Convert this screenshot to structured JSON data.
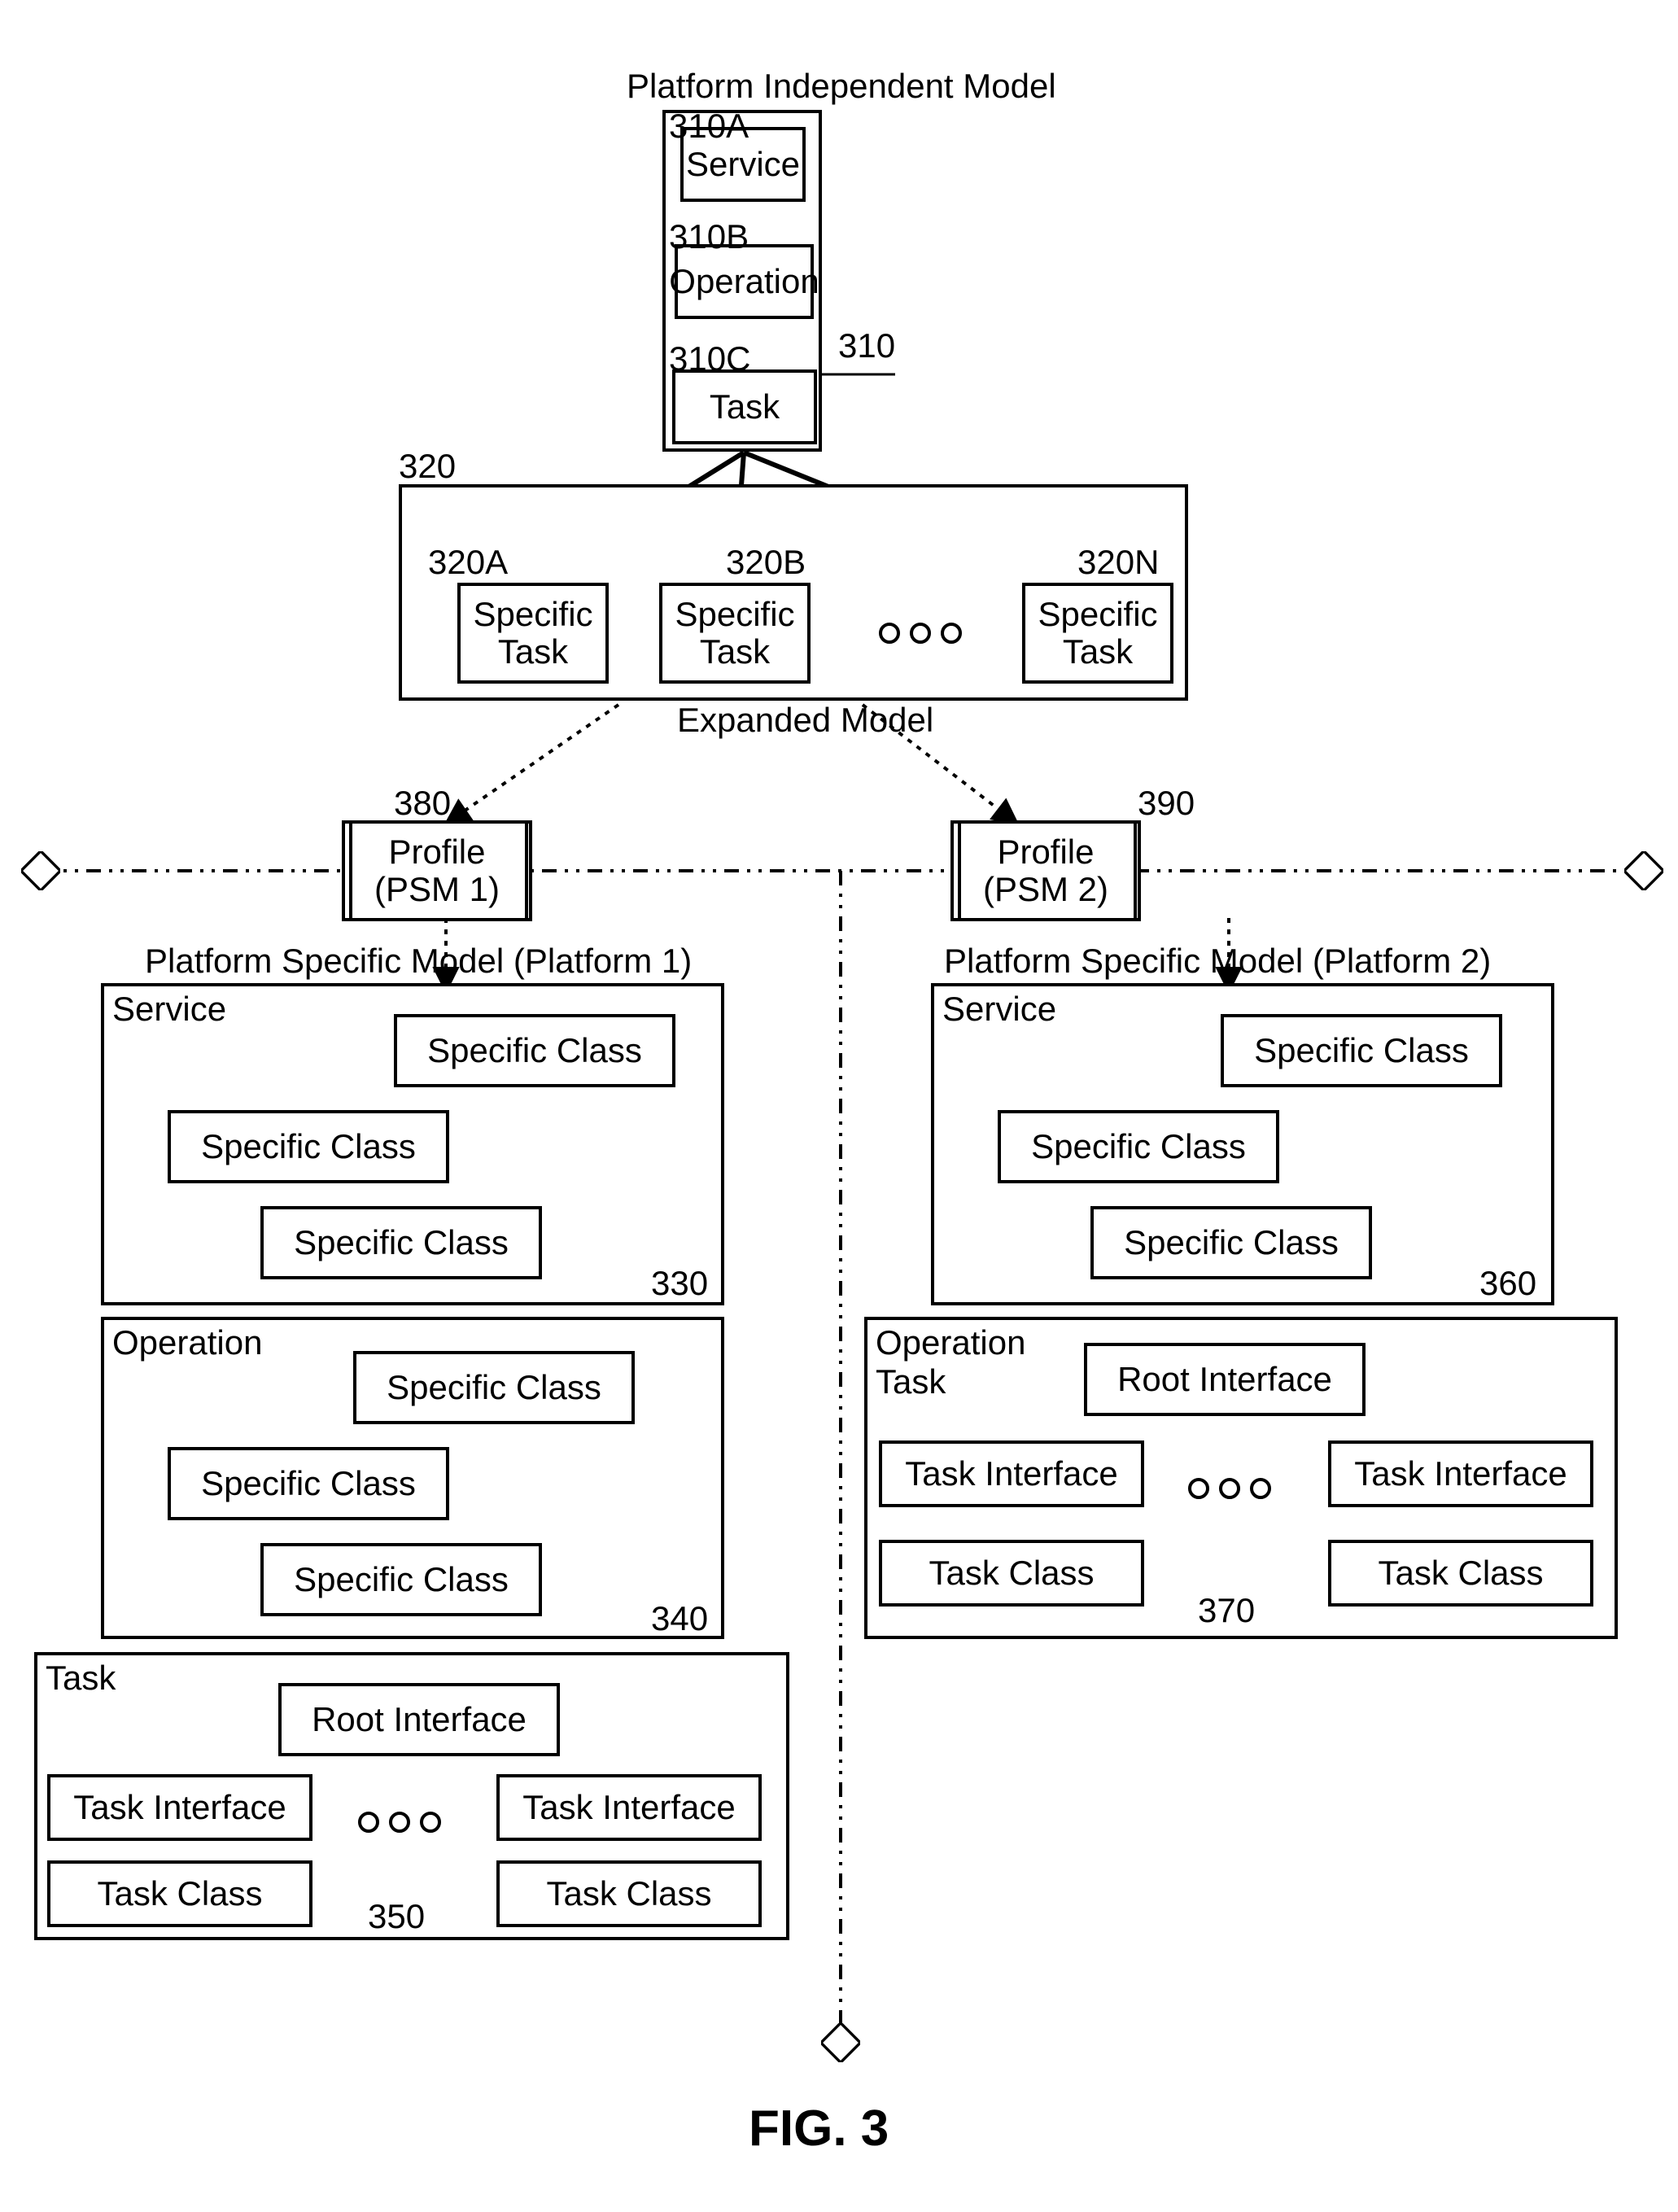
{
  "figure": {
    "caption": "FIG. 3"
  },
  "pim": {
    "title": "Platform Independent Model",
    "serviceLabel": "Service",
    "operationLabel": "Operation",
    "taskLabel": "Task",
    "ref": "310",
    "refA": "310A",
    "refB": "310B",
    "refC": "310C"
  },
  "expanded": {
    "title": "Expanded Model",
    "ref": "320",
    "refA": "320A",
    "refB": "320B",
    "refN": "320N",
    "st1": "Specific Task",
    "st2": "Specific Task",
    "st3": "Specific Task"
  },
  "profiles": {
    "p1": {
      "line1": "Profile",
      "line2": "(PSM 1)",
      "ref": "380"
    },
    "p2": {
      "line1": "Profile",
      "line2": "(PSM 2)",
      "ref": "390"
    }
  },
  "psm1": {
    "title": "Platform Specific Model (Platform 1)",
    "service": {
      "label": "Service",
      "sc1": "Specific Class",
      "sc2": "Specific Class",
      "sc3": "Specific Class",
      "ref": "330"
    },
    "operation": {
      "label": "Operation",
      "sc1": "Specific Class",
      "sc2": "Specific Class",
      "sc3": "Specific Class",
      "ref": "340"
    },
    "task": {
      "label": "Task",
      "root": "Root Interface",
      "ti1": "Task Interface",
      "ti2": "Task Interface",
      "tc1": "Task Class",
      "tc2": "Task Class",
      "ref": "350"
    }
  },
  "psm2": {
    "title": "Platform Specific Model (Platform 2)",
    "service": {
      "label": "Service",
      "sc1": "Specific Class",
      "sc2": "Specific Class",
      "sc3": "Specific Class",
      "ref": "360"
    },
    "operationTask": {
      "label1": "Operation",
      "label2": "Task",
      "root": "Root Interface",
      "ti1": "Task Interface",
      "ti2": "Task Interface",
      "tc1": "Task Class",
      "tc2": "Task Class",
      "ref": "370"
    }
  }
}
